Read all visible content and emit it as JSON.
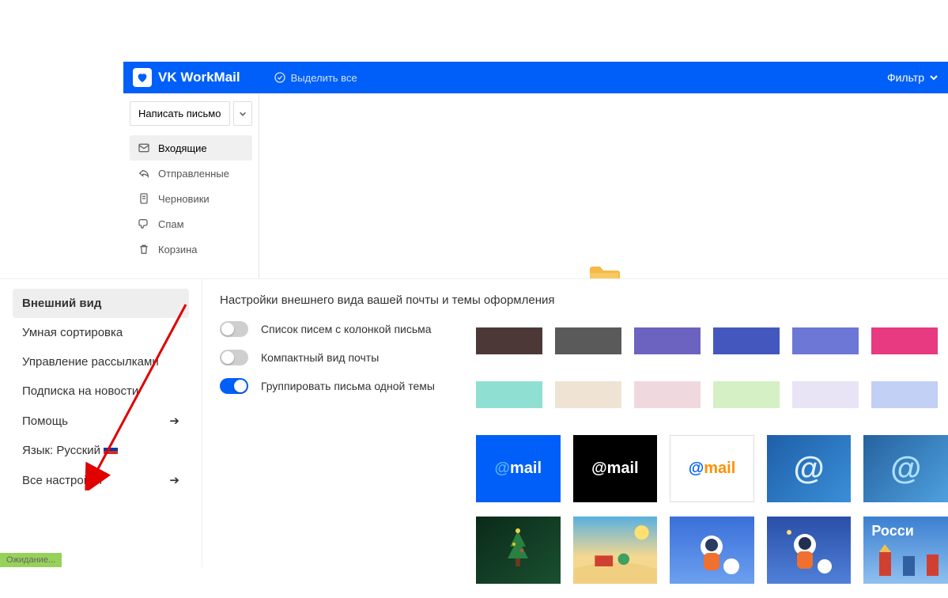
{
  "header": {
    "brand": "VK WorkMail",
    "select_all": "Выделить все",
    "filter": "Фильтр"
  },
  "compose": {
    "label": "Написать письмо"
  },
  "folders": [
    {
      "key": "inbox",
      "label": "Входящие",
      "icon": "inbox-icon",
      "active": true
    },
    {
      "key": "sent",
      "label": "Отправленные",
      "icon": "reply-icon",
      "active": false
    },
    {
      "key": "drafts",
      "label": "Черновики",
      "icon": "file-icon",
      "active": false
    },
    {
      "key": "spam",
      "label": "Спам",
      "icon": "thumbsdown-icon",
      "active": false
    },
    {
      "key": "trash",
      "label": "Корзина",
      "icon": "trash-icon",
      "active": false
    }
  ],
  "settings": {
    "sidebar": [
      {
        "key": "appearance",
        "label": "Внешний вид",
        "active": true,
        "arrow": false
      },
      {
        "key": "smart",
        "label": "Умная сортировка",
        "active": false,
        "arrow": false
      },
      {
        "key": "newsletters",
        "label": "Управление рассылками",
        "active": false,
        "arrow": false
      },
      {
        "key": "subscribe",
        "label": "Подписка на новости",
        "active": false,
        "arrow": false
      },
      {
        "key": "help",
        "label": "Помощь",
        "active": false,
        "arrow": true
      },
      {
        "key": "lang",
        "label": "Язык: Русский",
        "active": false,
        "arrow": false,
        "flag": true
      },
      {
        "key": "all",
        "label": "Все настройки",
        "active": false,
        "arrow": true
      }
    ],
    "title": "Настройки внешнего вида вашей почты и темы оформления",
    "toggles": [
      {
        "key": "column",
        "label": "Список писем с колонкой письма",
        "on": false
      },
      {
        "key": "compact",
        "label": "Компактный вид почты",
        "on": false
      },
      {
        "key": "group",
        "label": "Группировать письма одной темы",
        "on": true
      }
    ],
    "swatches_row1": [
      "#4d3838",
      "#5a5a5a",
      "#6c63c0",
      "#4457be",
      "#6c77d6",
      "#e83a80"
    ],
    "swatches_row2": [
      "#8fe0d2",
      "#efe4d4",
      "#f0d9de",
      "#d4f0c4",
      "#e8e4f5",
      "#c2d0f5"
    ],
    "theme_tiles_row1": [
      {
        "key": "blue",
        "bg": "#005ff9",
        "text": "@ mail",
        "text_color": "#fff",
        "accent": "#56b2ff"
      },
      {
        "key": "black",
        "bg": "#000",
        "text": "@ mail",
        "text_color": "#fff",
        "accent": "#fff"
      },
      {
        "key": "white",
        "bg": "#fff",
        "text": "@ mail",
        "text_color": "#ff9100",
        "accent": "#005ff9",
        "border": true
      },
      {
        "key": "ice1",
        "bg": "linear-gradient(135deg,#1e5fa8,#3a8fd8)",
        "text": "@",
        "text_color": "#e0f0ff"
      },
      {
        "key": "ice2",
        "bg": "linear-gradient(135deg,#25629e,#4fa0e0)",
        "text": "@",
        "text_color": "#aee0ff"
      }
    ],
    "theme_tiles_row2": [
      {
        "key": "xmas",
        "bg": "linear-gradient(140deg,#0a2a1a,#1a5030)",
        "decor": "tree"
      },
      {
        "key": "beach",
        "bg": "linear-gradient(180deg,#58b0e0,#f5d890 60%)",
        "decor": "beach"
      },
      {
        "key": "space1",
        "bg": "linear-gradient(180deg,#3a6fd8,#6ca0f0)",
        "decor": "astro"
      },
      {
        "key": "space2",
        "bg": "linear-gradient(180deg,#2a4fa8,#5080d8)",
        "decor": "astro2"
      },
      {
        "key": "russia",
        "bg": "linear-gradient(180deg,#3a7fd0,#90c0f0)",
        "decor": "russia",
        "label": "Росси"
      }
    ]
  },
  "status": {
    "loading": "Ожидание..."
  }
}
